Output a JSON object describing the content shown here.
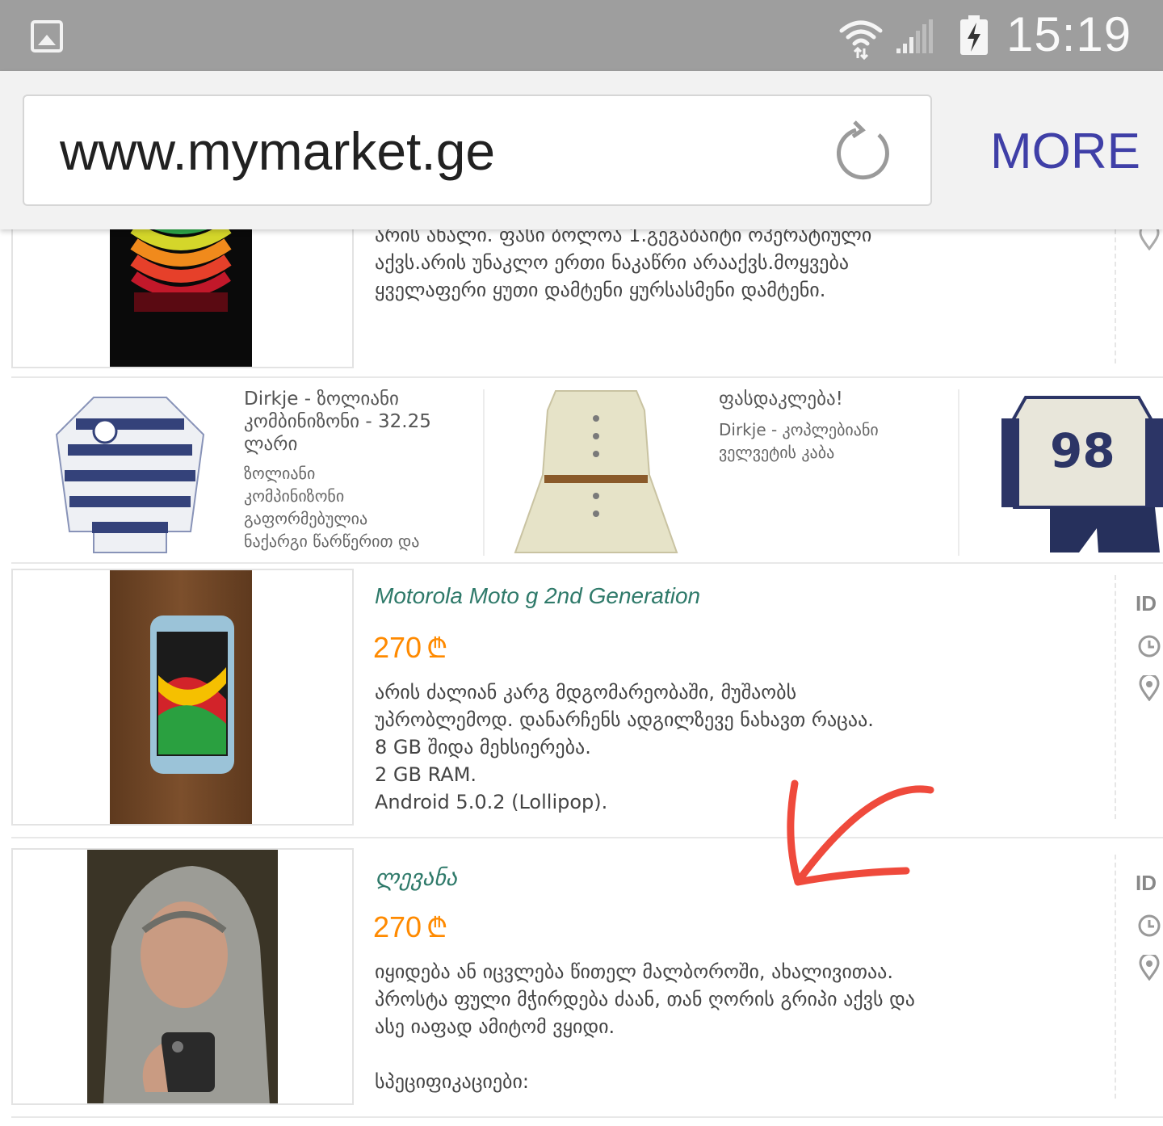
{
  "status_bar": {
    "time": "15:19",
    "icons": [
      "gallery-icon",
      "wifi-icon",
      "signal-icon",
      "battery-charging-icon"
    ]
  },
  "browser": {
    "url": "www.mymarket.ge",
    "more_label": "MORE",
    "reload_icon": "reload-icon",
    "accent_color": "#3f3fa7"
  },
  "listing_top": {
    "desc": "არის ახალი. ფასი ბოლოა 1.გეგაბაიტი ოპერატიული\nაქვს.არის უნაკლო ერთი ნაკაწრი არააქვს.მოყვება\nყველაფერი ყუთი დამტენი ყურსასმენი დამტენი."
  },
  "promos": [
    {
      "title": "Dirkje - ზოლიანი\nკომბინიზონი - 32.25\nლარი",
      "desc": "ზოლიანი\nკომპინიზონი\nგაფორმებულია\nნაქარგი წარწერით და"
    },
    {
      "title": "ფასდაკლება!",
      "desc": "Dirkje - კოპლებიანი\nველვეტის კაბა"
    }
  ],
  "listings": [
    {
      "title": "Motorola Moto g 2nd Generation",
      "price": "270",
      "currency": "₾",
      "desc": "არის ძალიან კარგ მდგომარეობაში, მუშაობს\nუპრობლემოდ. დანარჩენს ადგილზევე ნახავთ რაცაა.\n8 GB შიდა მეხსიერება.\n2 GB RAM.\nAndroid 5.0.2 (Lollipop).",
      "side_id": "ID"
    },
    {
      "title": "ლევანა",
      "price": "270",
      "currency": "₾",
      "desc": "იყიდება ან იცვლება წითელ მალბოროში, ახალივითაა.\nპროსტა ფული მჭირდება ძაან, თან ღორის გრიპი აქვს და\nასე იაფად ამიტომ ვყიდი.\n\nსპეციფიკაციები:",
      "side_id": "ID"
    }
  ],
  "colors": {
    "title": "#2f7a6a",
    "price": "#ff8a00",
    "annotation_arrow": "#ef4a3c"
  }
}
